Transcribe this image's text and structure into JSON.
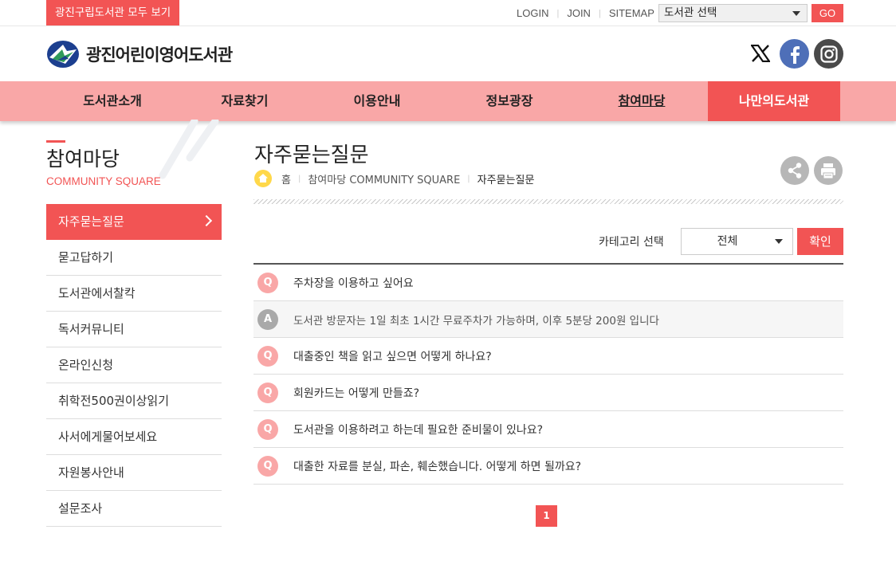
{
  "topbar": {
    "all_libraries": "광진구립도서관 모두 보기",
    "login": "LOGIN",
    "join": "JOIN",
    "sitemap": "SITEMAP",
    "library_select": "도서관 선택",
    "go": "GO"
  },
  "header": {
    "logo_text": "광진어린이영어도서관",
    "sns": [
      "x-icon",
      "facebook-icon",
      "instagram-icon"
    ]
  },
  "gnb": [
    {
      "label": "도서관소개"
    },
    {
      "label": "자료찾기"
    },
    {
      "label": "이용안내"
    },
    {
      "label": "정보광장"
    },
    {
      "label": "참여마당"
    },
    {
      "label": "나만의도서관"
    }
  ],
  "lnb": {
    "title": "참여마당",
    "subtitle": "COMMUNITY SQUARE",
    "items": [
      {
        "label": "자주묻는질문"
      },
      {
        "label": "묻고답하기"
      },
      {
        "label": "도서관에서찰칵"
      },
      {
        "label": "독서커뮤니티"
      },
      {
        "label": "온라인신청"
      },
      {
        "label": "취학전500권이상읽기"
      },
      {
        "label": "사서에게물어보세요"
      },
      {
        "label": "자원봉사안내"
      },
      {
        "label": "설문조사"
      }
    ]
  },
  "content": {
    "title": "자주묻는질문",
    "breadcrumb": {
      "home": "홈",
      "section": "참여마당 COMMUNITY SQUARE",
      "current": "자주묻는질문"
    },
    "filter": {
      "label": "카테고리 선택",
      "selected": "전체",
      "confirm": "확인"
    },
    "faq": [
      {
        "badge": "Q",
        "text": "주차장을 이용하고 싶어요"
      },
      {
        "badge": "A",
        "text": "도서관 방문자는 1일 최초 1시간 무료주차가 가능하며, 이후 5분당 200원 입니다"
      },
      {
        "badge": "Q",
        "text": "대출중인 책을 읽고 싶으면 어떻게 하나요?"
      },
      {
        "badge": "Q",
        "text": "회원카드는 어떻게 만들죠?"
      },
      {
        "badge": "Q",
        "text": "도서관을 이용하려고 하는데 필요한 준비물이 있나요?"
      },
      {
        "badge": "Q",
        "text": "대출한 자료를 분실, 파손, 훼손했습니다. 어떻게 하면 될까요?"
      }
    ],
    "pagination": {
      "current": "1"
    }
  },
  "colors": {
    "accent": "#f25454",
    "gnb_bg": "#f9a7a7",
    "question_badge": "#f9a7a7",
    "answer_badge": "#a9a9a9"
  }
}
